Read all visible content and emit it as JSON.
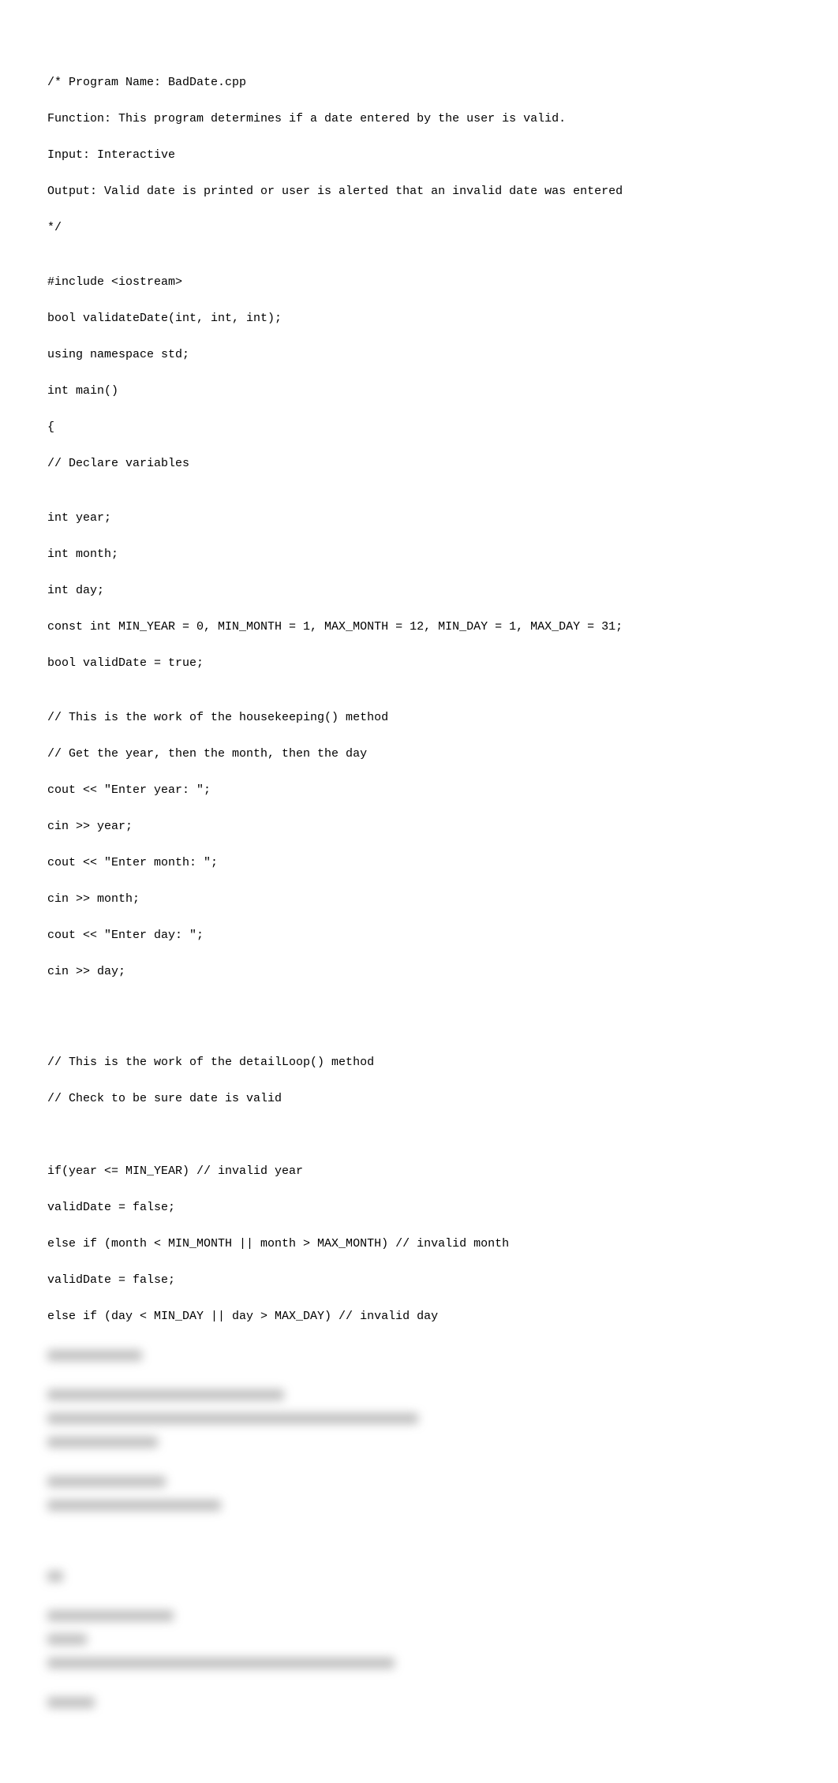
{
  "code": {
    "l01": "/* Program Name: BadDate.cpp",
    "l02": "Function: This program determines if a date entered by the user is valid.",
    "l03": "Input: Interactive",
    "l04": "Output: Valid date is printed or user is alerted that an invalid date was entered",
    "l05": "*/",
    "l06": "",
    "l07": "#include <iostream>",
    "l08": "bool validateDate(int, int, int);",
    "l09": "using namespace std;",
    "l10": "int main()",
    "l11": "{",
    "l12": "// Declare variables",
    "l13": "",
    "l14": "int year;",
    "l15": "int month;",
    "l16": "int day;",
    "l17": "const int MIN_YEAR = 0, MIN_MONTH = 1, MAX_MONTH = 12, MIN_DAY = 1, MAX_DAY = 31;",
    "l18": "bool validDate = true;",
    "l19": "",
    "l20": "// This is the work of the housekeeping() method",
    "l21": "// Get the year, then the month, then the day",
    "l22": "cout << \"Enter year: \";",
    "l23": "cin >> year;",
    "l24": "cout << \"Enter month: \";",
    "l25": "cin >> month;",
    "l26": "cout << \"Enter day: \";",
    "l27": "cin >> day;",
    "l28": "",
    "l29": "",
    "l30": "",
    "l31": "// This is the work of the detailLoop() method",
    "l32": "// Check to be sure date is valid",
    "l33": "",
    "l34": "",
    "l35": "if(year <= MIN_YEAR) // invalid year",
    "l36": "validDate = false;",
    "l37": "else if (month < MIN_MONTH || month > MAX_MONTH) // invalid month",
    "l38": "validDate = false;",
    "l39": "else if (day < MIN_DAY || day > MAX_DAY) // invalid day"
  },
  "blurred": {
    "widths": [
      120,
      0,
      300,
      470,
      140,
      0,
      150,
      220,
      0,
      0,
      0,
      20,
      0,
      160,
      50,
      440,
      0,
      60
    ]
  }
}
